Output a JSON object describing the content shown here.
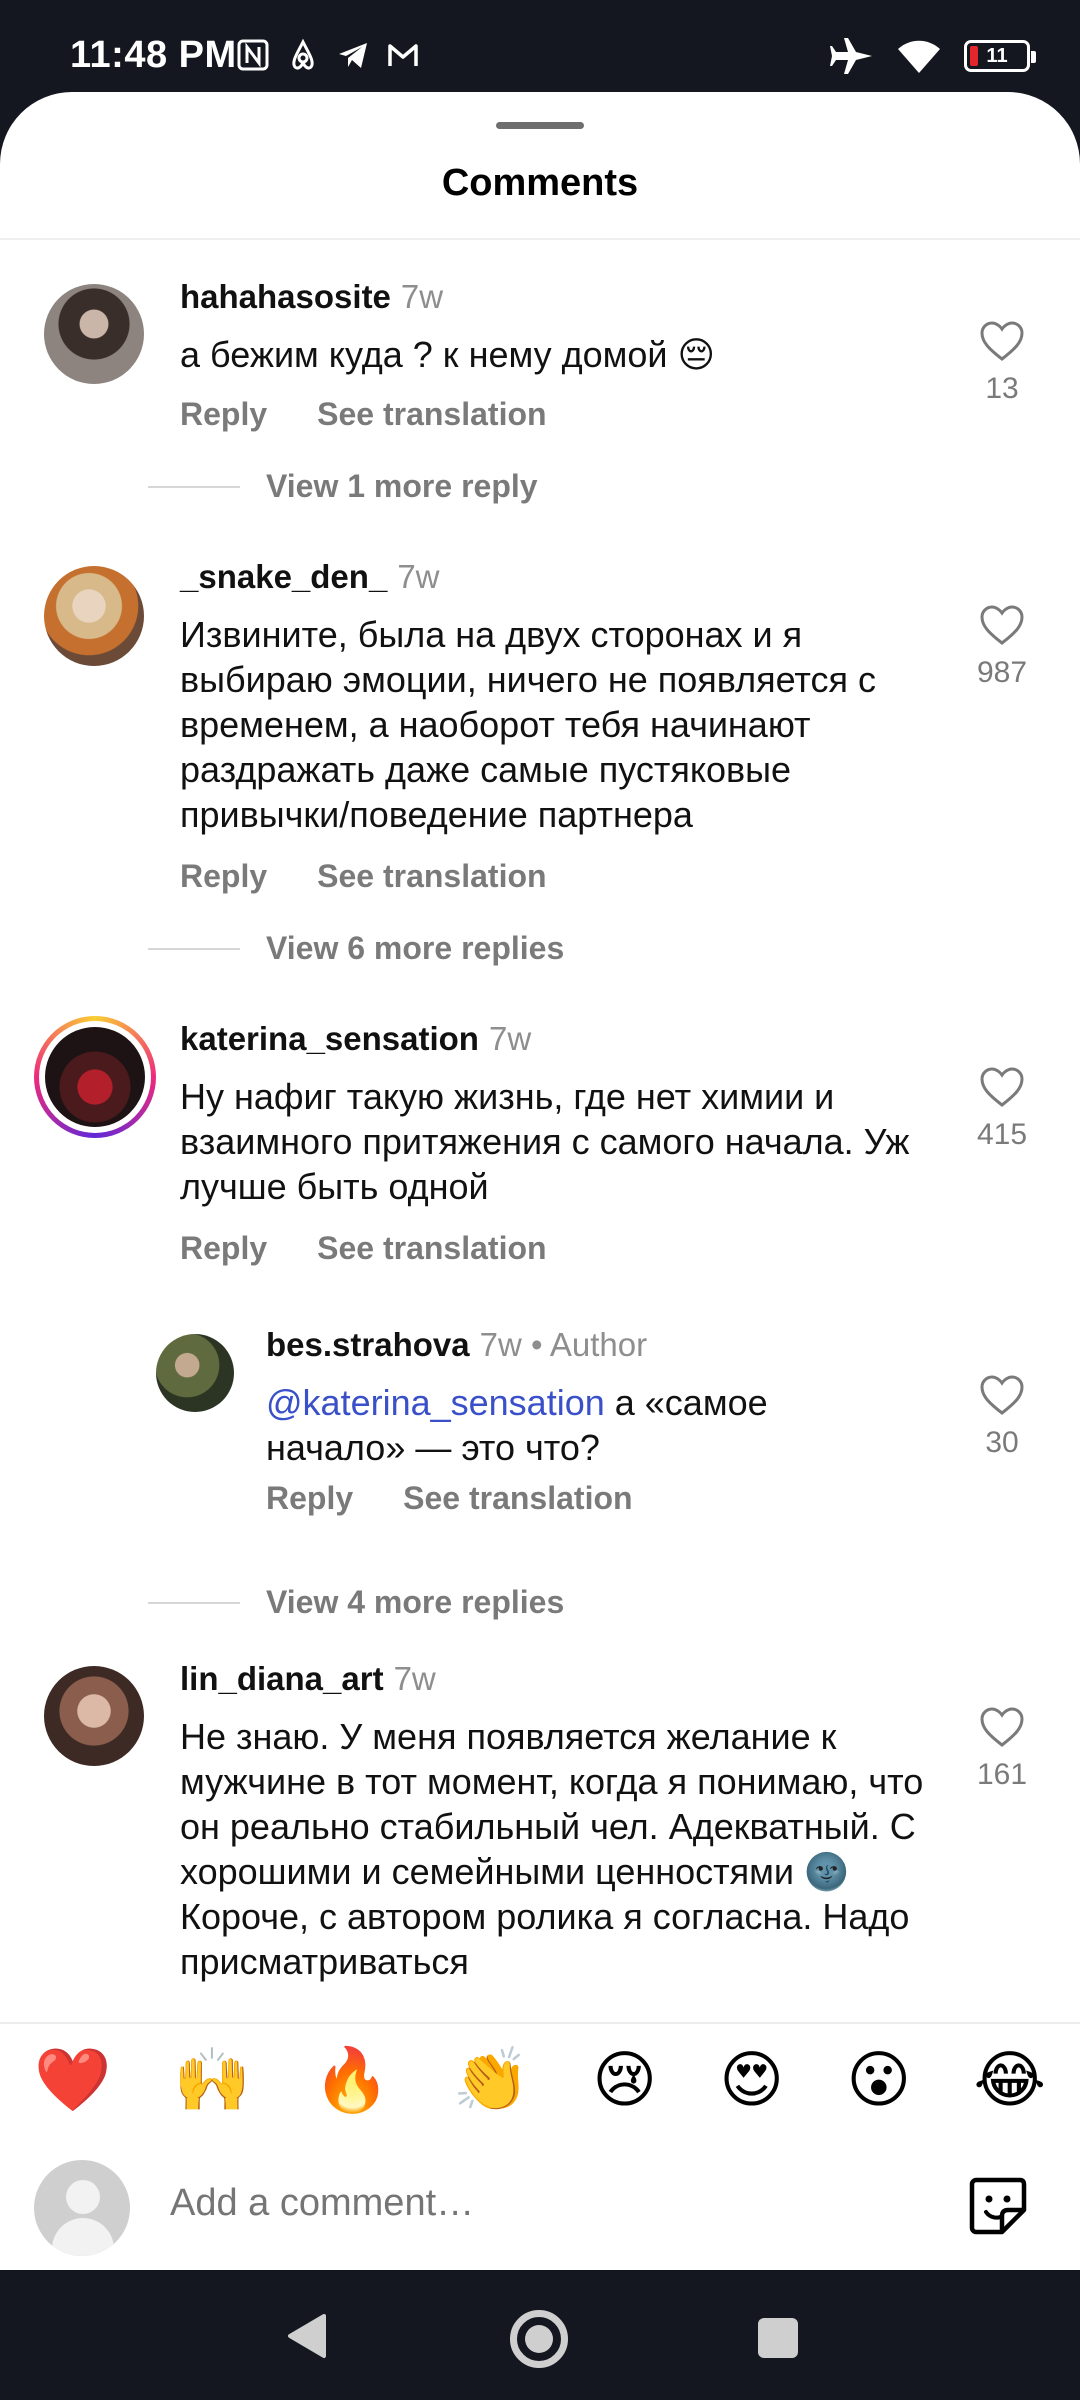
{
  "status_bar": {
    "time": "11:48 PM",
    "left_icons": [
      "nfc-icon",
      "airbnb-icon",
      "telegram-icon",
      "gmail-icon"
    ],
    "right_icons": [
      "airplane-mode-icon",
      "wifi-icon"
    ],
    "battery_level": "11",
    "battery_color": "#e3262b"
  },
  "sheet": {
    "title": "Comments"
  },
  "comments": [
    {
      "username": "hahahasosite",
      "time": "7w",
      "text": "а бежим куда ? к нему домой 😔",
      "reply_label": "Reply",
      "translate_label": "See translation",
      "likes": "13",
      "view_replies": "View 1 more reply"
    },
    {
      "username": "_snake_den_",
      "time": "7w",
      "text": "Извините, была на двух сторонах и я выбираю эмоции, ничего не появляется с временем, а наоборот тебя начинают раздражать даже самые пустяковые привычки/поведение партнера",
      "reply_label": "Reply",
      "translate_label": "See translation",
      "likes": "987",
      "view_replies": "View 6 more replies"
    },
    {
      "username": "katerina_sensation",
      "time": "7w",
      "text": "Ну нафиг такую жизнь, где нет химии и взаимного притяжения с самого начала. Уж лучше быть одной",
      "reply_label": "Reply",
      "translate_label": "See translation",
      "likes": "415",
      "view_replies": "View 4 more replies"
    },
    {
      "username": "lin_diana_art",
      "time": "7w",
      "text": "Не знаю. У меня появляется желание к мужчине в тот момент, когда я понимаю, что он реально стабильный чел. Адекватный. С хорошими и семейными ценностями 🌚 Короче, с автором ролика я согласна. Надо присматриваться",
      "likes": "161"
    }
  ],
  "reply": {
    "username": "bes.strahova",
    "time": "7w",
    "author_tag": "• Author",
    "mention": "@katerina_sensation",
    "text": " а «самое начало» — это что?",
    "reply_label": "Reply",
    "translate_label": "See translation",
    "likes": "30"
  },
  "emoji_bar": [
    "❤️",
    "🙌",
    "🔥",
    "👏",
    "😢",
    "😍",
    "😮",
    "😂"
  ],
  "comment_input": {
    "placeholder": "Add a comment…"
  }
}
